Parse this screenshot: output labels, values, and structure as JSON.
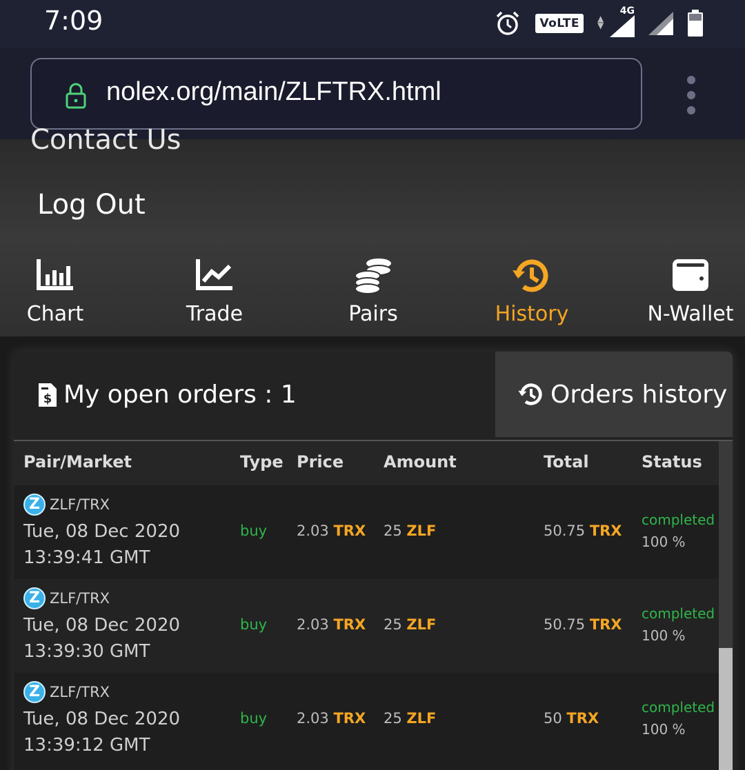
{
  "status_bar": {
    "time": "7:09",
    "volte": "VoLTE",
    "network": "4G"
  },
  "browser": {
    "url": "nolex.org/main/ZLFTRX.html"
  },
  "menu": {
    "contact": "Contact Us",
    "logout": "Log Out"
  },
  "nav": [
    {
      "label": "Chart",
      "icon": "bar-chart-icon"
    },
    {
      "label": "Trade",
      "icon": "trend-chart-icon"
    },
    {
      "label": "Pairs",
      "icon": "coins-icon"
    },
    {
      "label": "History",
      "icon": "history-icon",
      "active": true
    },
    {
      "label": "N-Wallet",
      "icon": "wallet-icon"
    }
  ],
  "tabs": {
    "open_orders": "My open orders : 1",
    "orders_history": "Orders history"
  },
  "table": {
    "headers": {
      "pair": "Pair/Market",
      "type": "Type",
      "price": "Price",
      "amount": "Amount",
      "total": "Total",
      "status": "Status"
    },
    "rows": [
      {
        "pair": "ZLF/TRX",
        "date": "Tue, 08 Dec 2020",
        "time": "13:39:41 GMT",
        "type": "buy",
        "price": "2.03",
        "price_cur": "TRX",
        "amount": "25",
        "amount_cur": "ZLF",
        "total": "50.75",
        "total_cur": "TRX",
        "status": "completed",
        "percent": "100 %"
      },
      {
        "pair": "ZLF/TRX",
        "date": "Tue, 08 Dec 2020",
        "time": "13:39:30 GMT",
        "type": "buy",
        "price": "2.03",
        "price_cur": "TRX",
        "amount": "25",
        "amount_cur": "ZLF",
        "total": "50.75",
        "total_cur": "TRX",
        "status": "completed",
        "percent": "100 %"
      },
      {
        "pair": "ZLF/TRX",
        "date": "Tue, 08 Dec 2020",
        "time": "13:39:12 GMT",
        "type": "buy",
        "price": "2.03",
        "price_cur": "TRX",
        "amount": "25",
        "amount_cur": "ZLF",
        "total": "50",
        "total_cur": "TRX",
        "status": "completed",
        "percent": "100 %"
      }
    ]
  },
  "colors": {
    "accent": "#f5a623",
    "success": "#2fb54a",
    "topbar": "#1f2233"
  }
}
